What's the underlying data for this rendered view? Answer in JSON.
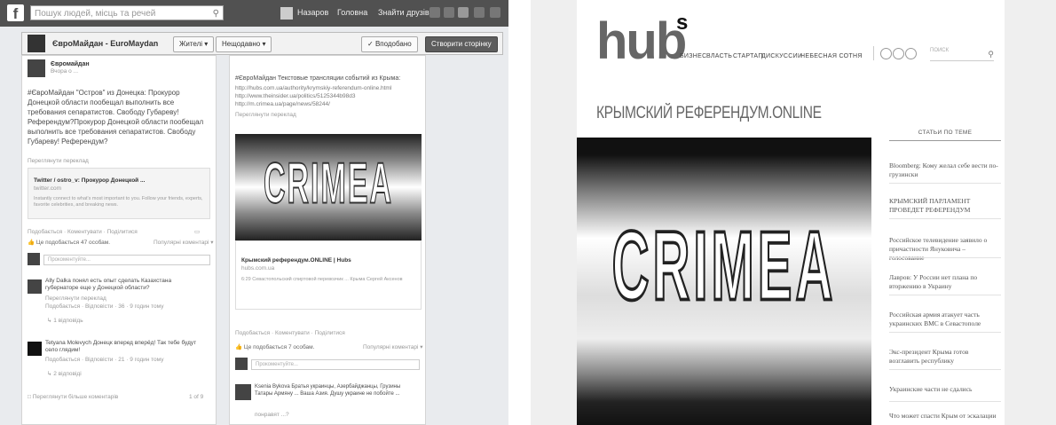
{
  "fb": {
    "search_placeholder": "Пошук людей, місць та речей",
    "top_nav": [
      "Назаров",
      "Головна",
      "Знайти друзів"
    ],
    "page_name": "ЄвроМайдан - EuroMaydan",
    "liked_btn": "Вподобано",
    "create_page_btn": "Створити сторінку",
    "btn_following": "Жителі",
    "btn_messages": "Нещодавно",
    "left_post": {
      "avatar_label": "Євромайдан",
      "time": "Вчора о ...",
      "text": "#ЄвроМайдан \"Остров\" из Донецка: Прокурор Донецкой области пообещал выполнить все требования сепаратистов. Свободу Губареву! Референдум?Прокурор Донецкой области пообещал выполнить все требования сепаратистов. Свободу Губареву! Референдум?",
      "translation": "Переглянути переклад",
      "link_title": "Twitter / ostro_v: Прокурор Донецкой ...",
      "link_domain": "twitter.com",
      "link_desc": "Instantly connect to what's most important to you. Follow your friends, experts, favorite celebrities, and breaking news.",
      "actions": "Подобається · Коментувати · Поділитися",
      "likes": "Це подобається 47 особам.",
      "sort": "Популярні коментарі",
      "comment_ph": "Прокоментуйте...",
      "comments": [
        {
          "text": "Ally Dalka понял есть опыт сделать Казахстана губернаторе еще у Донецкой области?",
          "meta": "Переглянути переклад",
          "act": "Подобається · Відповісти · 36 · 9 годин тому",
          "reply": "1 відповідь"
        },
        {
          "text": "Tetyana Molevych Донецк вперед вперёд! Так тебе будут село глядим!",
          "meta": "Подобається · Відповісти · 21 · 9 годин тому",
          "act": "",
          "reply": "2 відповіді"
        }
      ],
      "more": "Переглянути більше коментарів",
      "count": "1 of 9"
    },
    "right_post": {
      "text": "#ЄвроМайдан Текстовые трансляции событий из Крыма:",
      "links": [
        "http://hubs.com.ua/authority/krymskiy-referendum-online.html",
        "http://www.theinsider.ua/politics/5125344b98d3",
        "http://m.crimea.ua/page/news/58244/"
      ],
      "translation": "Переглянути переклад",
      "img_word": "CRIMEA",
      "link_title": "Крымский референдум.ONLINE | Hubs",
      "link_domain": "hubs.com.ua",
      "link_desc": "6:29 Севастопольский спиртовой перевозчик ... Крыма Сергей Аксенов",
      "actions": "Подобається · Коментувати · Поділитися",
      "likes": "Це подобається 7 особам.",
      "sort": "Популярні коментарі",
      "comment_ph": "Прокоментуйте...",
      "comment_text": "Ksenia Bykova Братья украинцы, Азербайджанцы, Грузины Татары Армяну ... Ваша Азия. Душу украине не побойте ...",
      "comment_tail": "понравят ...?"
    }
  },
  "hubs": {
    "logo": "hub",
    "logo_sup": "s",
    "nav": [
      "БИЗНЕС",
      "ВЛАСТЬ",
      "СТАРТАП",
      "ДИСКУССИИ",
      "НЕБЕСНАЯ СОТНЯ"
    ],
    "search_placeholder": "ПОИСК",
    "title": "КРЫМСКИЙ РЕФЕРЕНДУМ.ONLINE",
    "hero_word": "CRIMEA",
    "sidebar_title": "СТАТЬИ ПО ТЕМЕ",
    "sidebar_items": [
      "Bloomberg: Кому желал себе вести по-грузински",
      "КРЫМСКИЙ ПАРЛАМЕНТ ПРОВЕДЕТ РЕФЕРЕНДУМ",
      "Российское телевидение заявило о причастности Януковича – голосование",
      "Лавров: У России нет плана по вторжению в Украину",
      "Российская армия атакует часть украинских ВМС в Севастополе",
      "Экс-президент Крыма готов возглавить республику",
      "Украинские части не сдались",
      "Что может спасти Крым от эскалации"
    ]
  }
}
